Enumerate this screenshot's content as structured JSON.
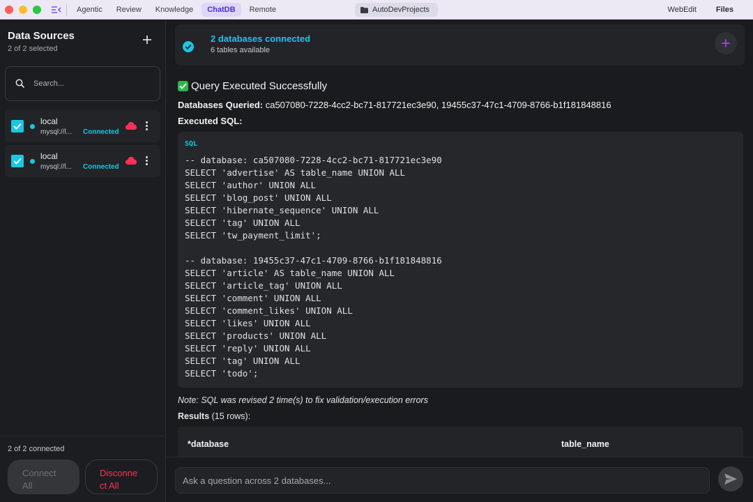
{
  "titlebar": {
    "tabs": [
      {
        "label": "Agentic",
        "active": false
      },
      {
        "label": "Review",
        "active": false
      },
      {
        "label": "Knowledge",
        "active": false
      },
      {
        "label": "ChatDB",
        "active": true
      },
      {
        "label": "Remote",
        "active": false
      }
    ],
    "project": "AutoDevProjects",
    "right": {
      "webedit": "WebEdit",
      "files": "Files"
    }
  },
  "sidebar": {
    "title": "Data Sources",
    "subtitle": "2 of 2 selected",
    "search_placeholder": "Search...",
    "items": [
      {
        "name": "local",
        "url": "mysql://localhost",
        "url_display": "mysql://l...",
        "status": "Connected",
        "checked": true
      },
      {
        "name": "local",
        "url": "mysql://localhost",
        "url_display": "mysql://l...",
        "status": "Connected",
        "checked": true
      }
    ],
    "count": "2 of 2 connected",
    "connect_all_line1": "Connect",
    "connect_all_line2": "All",
    "disconnect_all_line1": "Disconne",
    "disconnect_all_line2": "ct All"
  },
  "banner": {
    "title": "2 databases connected",
    "subtitle": "6 tables available"
  },
  "result": {
    "title": "Query Executed Successfully",
    "db_label": "Databases Queried:",
    "db_value": " ca507080-7228-4cc2-bc71-817721ec3e90, 19455c37-47c1-4709-8766-b1f181848816",
    "sql_label": "Executed SQL:",
    "code_lang": "SQL",
    "code": "-- database: ca507080-7228-4cc2-bc71-817721ec3e90\nSELECT 'advertise' AS table_name UNION ALL\nSELECT 'author' UNION ALL\nSELECT 'blog_post' UNION ALL\nSELECT 'hibernate_sequence' UNION ALL\nSELECT 'tag' UNION ALL\nSELECT 'tw_payment_limit';\n\n-- database: 19455c37-47c1-4709-8766-b1f181848816\nSELECT 'article' AS table_name UNION ALL\nSELECT 'article_tag' UNION ALL\nSELECT 'comment' UNION ALL\nSELECT 'comment_likes' UNION ALL\nSELECT 'likes' UNION ALL\nSELECT 'products' UNION ALL\nSELECT 'reply' UNION ALL\nSELECT 'tag' UNION ALL\nSELECT 'todo';",
    "note": "Note: SQL was revised 2 time(s) to fix validation/execution errors",
    "results_label": "Results",
    "results_count": " (15 rows):",
    "columns": [
      "*database",
      "table_name"
    ]
  },
  "input": {
    "placeholder": "Ask a question across 2 databases..."
  },
  "colors": {
    "accent_cyan": "#19c7e4",
    "danger": "#ff3158",
    "tab_active": "#4b2fd1"
  }
}
